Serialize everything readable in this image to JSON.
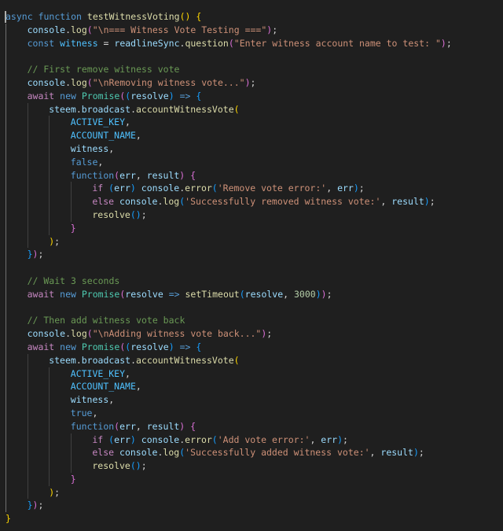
{
  "editor": {
    "theme_colors": {
      "background": "#1f1f1f",
      "keyword": "#569cd6",
      "control": "#c586c0",
      "function": "#dcdcaa",
      "variable": "#9cdcfe",
      "constant": "#4fc1ff",
      "string": "#ce9178",
      "comment": "#6a9955",
      "number": "#b5cea8",
      "class": "#4ec9b0"
    },
    "lines": [
      {
        "i": 0,
        "t": [
          [
            "kw",
            "async"
          ],
          [
            "p",
            " "
          ],
          [
            "kw",
            "function"
          ],
          [
            "p",
            " "
          ],
          [
            "fn",
            "testWitnessVoting"
          ],
          [
            "b1",
            "()"
          ],
          [
            "p",
            " "
          ],
          [
            "b1",
            "{"
          ]
        ]
      },
      {
        "i": 1,
        "t": [
          [
            "var",
            "console"
          ],
          [
            "p",
            "."
          ],
          [
            "fn",
            "log"
          ],
          [
            "b2",
            "("
          ],
          [
            "str",
            "\"\\n=== Witness Vote Testing ===\""
          ],
          [
            "b2",
            ")"
          ],
          [
            "p",
            ";"
          ]
        ]
      },
      {
        "i": 1,
        "t": [
          [
            "kw",
            "const"
          ],
          [
            "p",
            " "
          ],
          [
            "const",
            "witness"
          ],
          [
            "p",
            " = "
          ],
          [
            "var",
            "readlineSync"
          ],
          [
            "p",
            "."
          ],
          [
            "fn",
            "question"
          ],
          [
            "b2",
            "("
          ],
          [
            "str",
            "\"Enter witness account name to test: \""
          ],
          [
            "b2",
            ")"
          ],
          [
            "p",
            ";"
          ]
        ]
      },
      {
        "i": 1,
        "t": []
      },
      {
        "i": 1,
        "t": [
          [
            "cmt",
            "// First remove witness vote"
          ]
        ]
      },
      {
        "i": 1,
        "t": [
          [
            "var",
            "console"
          ],
          [
            "p",
            "."
          ],
          [
            "fn",
            "log"
          ],
          [
            "b2",
            "("
          ],
          [
            "str",
            "\"\\nRemoving witness vote...\""
          ],
          [
            "b2",
            ")"
          ],
          [
            "p",
            ";"
          ]
        ]
      },
      {
        "i": 1,
        "t": [
          [
            "ctl",
            "await"
          ],
          [
            "p",
            " "
          ],
          [
            "kw",
            "new"
          ],
          [
            "p",
            " "
          ],
          [
            "cls",
            "Promise"
          ],
          [
            "b2",
            "("
          ],
          [
            "b3",
            "("
          ],
          [
            "var",
            "resolve"
          ],
          [
            "b3",
            ")"
          ],
          [
            "p",
            " "
          ],
          [
            "kw",
            "=>"
          ],
          [
            "p",
            " "
          ],
          [
            "b3",
            "{"
          ]
        ]
      },
      {
        "i": 2,
        "t": [
          [
            "var",
            "steem"
          ],
          [
            "p",
            "."
          ],
          [
            "var",
            "broadcast"
          ],
          [
            "p",
            "."
          ],
          [
            "fn",
            "accountWitnessVote"
          ],
          [
            "b1",
            "("
          ]
        ]
      },
      {
        "i": 3,
        "t": [
          [
            "const",
            "ACTIVE_KEY"
          ],
          [
            "p",
            ","
          ]
        ]
      },
      {
        "i": 3,
        "t": [
          [
            "const",
            "ACCOUNT_NAME"
          ],
          [
            "p",
            ","
          ]
        ]
      },
      {
        "i": 3,
        "t": [
          [
            "var",
            "witness"
          ],
          [
            "p",
            ","
          ]
        ]
      },
      {
        "i": 3,
        "t": [
          [
            "kw",
            "false"
          ],
          [
            "p",
            ","
          ]
        ]
      },
      {
        "i": 3,
        "t": [
          [
            "kw",
            "function"
          ],
          [
            "b2",
            "("
          ],
          [
            "var",
            "err"
          ],
          [
            "p",
            ", "
          ],
          [
            "var",
            "result"
          ],
          [
            "b2",
            ")"
          ],
          [
            "p",
            " "
          ],
          [
            "b2",
            "{"
          ]
        ]
      },
      {
        "i": 4,
        "t": [
          [
            "ctl",
            "if"
          ],
          [
            "p",
            " "
          ],
          [
            "b3",
            "("
          ],
          [
            "var",
            "err"
          ],
          [
            "b3",
            ")"
          ],
          [
            "p",
            " "
          ],
          [
            "var",
            "console"
          ],
          [
            "p",
            "."
          ],
          [
            "fn",
            "error"
          ],
          [
            "b3",
            "("
          ],
          [
            "str",
            "'Remove vote error:'"
          ],
          [
            "p",
            ", "
          ],
          [
            "var",
            "err"
          ],
          [
            "b3",
            ")"
          ],
          [
            "p",
            ";"
          ]
        ]
      },
      {
        "i": 4,
        "t": [
          [
            "ctl",
            "else"
          ],
          [
            "p",
            " "
          ],
          [
            "var",
            "console"
          ],
          [
            "p",
            "."
          ],
          [
            "fn",
            "log"
          ],
          [
            "b3",
            "("
          ],
          [
            "str",
            "'Successfully removed witness vote:'"
          ],
          [
            "p",
            ", "
          ],
          [
            "var",
            "result"
          ],
          [
            "b3",
            ")"
          ],
          [
            "p",
            ";"
          ]
        ]
      },
      {
        "i": 4,
        "t": [
          [
            "fn",
            "resolve"
          ],
          [
            "b3",
            "()"
          ],
          [
            "p",
            ";"
          ]
        ]
      },
      {
        "i": 3,
        "t": [
          [
            "b2",
            "}"
          ]
        ]
      },
      {
        "i": 2,
        "t": [
          [
            "b1",
            ")"
          ],
          [
            "p",
            ";"
          ]
        ]
      },
      {
        "i": 1,
        "t": [
          [
            "b3",
            "}"
          ],
          [
            "b2",
            ")"
          ],
          [
            "p",
            ";"
          ]
        ]
      },
      {
        "i": 1,
        "t": []
      },
      {
        "i": 1,
        "t": [
          [
            "cmt",
            "// Wait 3 seconds"
          ]
        ]
      },
      {
        "i": 1,
        "t": [
          [
            "ctl",
            "await"
          ],
          [
            "p",
            " "
          ],
          [
            "kw",
            "new"
          ],
          [
            "p",
            " "
          ],
          [
            "cls",
            "Promise"
          ],
          [
            "b2",
            "("
          ],
          [
            "var",
            "resolve"
          ],
          [
            "p",
            " "
          ],
          [
            "kw",
            "=>"
          ],
          [
            "p",
            " "
          ],
          [
            "fn",
            "setTimeout"
          ],
          [
            "b3",
            "("
          ],
          [
            "var",
            "resolve"
          ],
          [
            "p",
            ", "
          ],
          [
            "num",
            "3000"
          ],
          [
            "b3",
            ")"
          ],
          [
            "b2",
            ")"
          ],
          [
            "p",
            ";"
          ]
        ]
      },
      {
        "i": 1,
        "t": []
      },
      {
        "i": 1,
        "t": [
          [
            "cmt",
            "// Then add witness vote back"
          ]
        ]
      },
      {
        "i": 1,
        "t": [
          [
            "var",
            "console"
          ],
          [
            "p",
            "."
          ],
          [
            "fn",
            "log"
          ],
          [
            "b2",
            "("
          ],
          [
            "str",
            "\"\\nAdding witness vote back...\""
          ],
          [
            "b2",
            ")"
          ],
          [
            "p",
            ";"
          ]
        ]
      },
      {
        "i": 1,
        "t": [
          [
            "ctl",
            "await"
          ],
          [
            "p",
            " "
          ],
          [
            "kw",
            "new"
          ],
          [
            "p",
            " "
          ],
          [
            "cls",
            "Promise"
          ],
          [
            "b2",
            "("
          ],
          [
            "b3",
            "("
          ],
          [
            "var",
            "resolve"
          ],
          [
            "b3",
            ")"
          ],
          [
            "p",
            " "
          ],
          [
            "kw",
            "=>"
          ],
          [
            "p",
            " "
          ],
          [
            "b3",
            "{"
          ]
        ]
      },
      {
        "i": 2,
        "t": [
          [
            "var",
            "steem"
          ],
          [
            "p",
            "."
          ],
          [
            "var",
            "broadcast"
          ],
          [
            "p",
            "."
          ],
          [
            "fn",
            "accountWitnessVote"
          ],
          [
            "b1",
            "("
          ]
        ]
      },
      {
        "i": 3,
        "t": [
          [
            "const",
            "ACTIVE_KEY"
          ],
          [
            "p",
            ","
          ]
        ]
      },
      {
        "i": 3,
        "t": [
          [
            "const",
            "ACCOUNT_NAME"
          ],
          [
            "p",
            ","
          ]
        ]
      },
      {
        "i": 3,
        "t": [
          [
            "var",
            "witness"
          ],
          [
            "p",
            ","
          ]
        ]
      },
      {
        "i": 3,
        "t": [
          [
            "kw",
            "true"
          ],
          [
            "p",
            ","
          ]
        ]
      },
      {
        "i": 3,
        "t": [
          [
            "kw",
            "function"
          ],
          [
            "b2",
            "("
          ],
          [
            "var",
            "err"
          ],
          [
            "p",
            ", "
          ],
          [
            "var",
            "result"
          ],
          [
            "b2",
            ")"
          ],
          [
            "p",
            " "
          ],
          [
            "b2",
            "{"
          ]
        ]
      },
      {
        "i": 4,
        "t": [
          [
            "ctl",
            "if"
          ],
          [
            "p",
            " "
          ],
          [
            "b3",
            "("
          ],
          [
            "var",
            "err"
          ],
          [
            "b3",
            ")"
          ],
          [
            "p",
            " "
          ],
          [
            "var",
            "console"
          ],
          [
            "p",
            "."
          ],
          [
            "fn",
            "error"
          ],
          [
            "b3",
            "("
          ],
          [
            "str",
            "'Add vote error:'"
          ],
          [
            "p",
            ", "
          ],
          [
            "var",
            "err"
          ],
          [
            "b3",
            ")"
          ],
          [
            "p",
            ";"
          ]
        ]
      },
      {
        "i": 4,
        "t": [
          [
            "ctl",
            "else"
          ],
          [
            "p",
            " "
          ],
          [
            "var",
            "console"
          ],
          [
            "p",
            "."
          ],
          [
            "fn",
            "log"
          ],
          [
            "b3",
            "("
          ],
          [
            "str",
            "'Successfully added witness vote:'"
          ],
          [
            "p",
            ", "
          ],
          [
            "var",
            "result"
          ],
          [
            "b3",
            ")"
          ],
          [
            "p",
            ";"
          ]
        ]
      },
      {
        "i": 4,
        "t": [
          [
            "fn",
            "resolve"
          ],
          [
            "b3",
            "()"
          ],
          [
            "p",
            ";"
          ]
        ]
      },
      {
        "i": 3,
        "t": [
          [
            "b2",
            "}"
          ]
        ]
      },
      {
        "i": 2,
        "t": [
          [
            "b1",
            ")"
          ],
          [
            "p",
            ";"
          ]
        ]
      },
      {
        "i": 1,
        "t": [
          [
            "b3",
            "}"
          ],
          [
            "b2",
            ")"
          ],
          [
            "p",
            ";"
          ]
        ]
      },
      {
        "i": 0,
        "t": [
          [
            "b1",
            "}"
          ]
        ]
      }
    ]
  }
}
